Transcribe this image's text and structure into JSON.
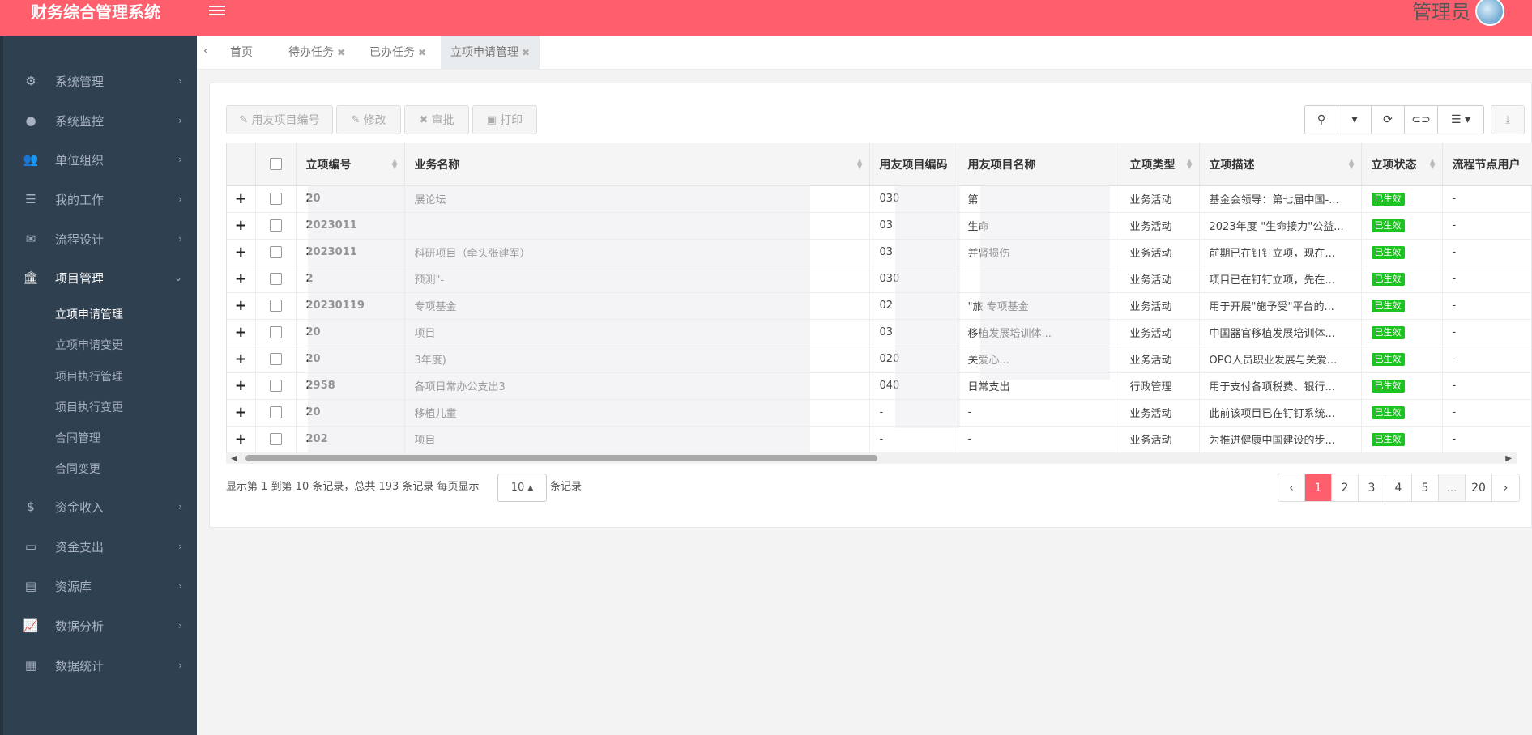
{
  "app": {
    "title": "财务综合管理系统",
    "user": "管理员"
  },
  "sidebar": {
    "items": [
      {
        "label": "系统管理",
        "icon": "gears-icon"
      },
      {
        "label": "系统监控",
        "icon": "info-circle-icon"
      },
      {
        "label": "单位组织",
        "icon": "users-icon"
      },
      {
        "label": "我的工作",
        "icon": "tasks-icon"
      },
      {
        "label": "流程设计",
        "icon": "envelope-icon"
      },
      {
        "label": "项目管理",
        "icon": "bank-icon"
      },
      {
        "label": "资金收入",
        "icon": "dollar-icon"
      },
      {
        "label": "资金支出",
        "icon": "credit-card-icon"
      },
      {
        "label": "资源库",
        "icon": "file-icon"
      },
      {
        "label": "数据分析",
        "icon": "line-chart-icon"
      },
      {
        "label": "数据统计",
        "icon": "calendar-icon"
      }
    ],
    "submenu": [
      "立项申请管理",
      "立项申请变更",
      "项目执行管理",
      "项目执行变更",
      "合同管理",
      "合同变更"
    ]
  },
  "tabs": [
    {
      "label": "首页"
    },
    {
      "label": "待办任务"
    },
    {
      "label": "已办任务"
    },
    {
      "label": "立项申请管理"
    }
  ],
  "toolbar": {
    "yonyou_code": "用友项目编号",
    "edit": "修改",
    "approve": "审批",
    "print": "打印"
  },
  "table": {
    "columns": [
      "立项编号",
      "业务名称",
      "用友项目编码",
      "用友项目名称",
      "立项类型",
      "立项描述",
      "立项状态",
      "流程节点用户"
    ],
    "rows": [
      {
        "id": "20",
        "name": "展论坛",
        "code": "030",
        "pname": "第",
        "type": "业务活动",
        "desc": "基金会领导：第七届中国-...",
        "status": "已生效",
        "node": "-"
      },
      {
        "id": "2023011",
        "name": "",
        "code": "03",
        "pname": "生命",
        "type": "业务活动",
        "desc": "2023年度-\"生命接力\"公益...",
        "status": "已生效",
        "node": "-"
      },
      {
        "id": "2023011",
        "name": "科研项目（牵头张建军）",
        "code": "03",
        "pname": "并肾损伤",
        "type": "业务活动",
        "desc": "前期已在钉钉立项，现在...",
        "status": "已生效",
        "node": "-"
      },
      {
        "id": "2",
        "name": "预测\"-",
        "code": "030",
        "pname": "",
        "type": "业务活动",
        "desc": "项目已在钉钉立项，先在...",
        "status": "已生效",
        "node": "-"
      },
      {
        "id": "20230119",
        "name": "专项基金",
        "code": "02",
        "pname": "\"旅  专项基金",
        "type": "业务活动",
        "desc": "用于开展\"施予受\"平台的...",
        "status": "已生效",
        "node": "-"
      },
      {
        "id": "20",
        "name": "项目",
        "code": "03",
        "pname": "移植发展培训体...",
        "type": "业务活动",
        "desc": "中国器官移植发展培训体...",
        "status": "已生效",
        "node": "-"
      },
      {
        "id": "20",
        "name": "3年度)",
        "code": "020",
        "pname": "关爱心...",
        "type": "业务活动",
        "desc": "OPO人员职业发展与关爱...",
        "status": "已生效",
        "node": "-"
      },
      {
        "id": "2958",
        "name": "各项日常办公支出3",
        "code": "040",
        "pname": "日常支出",
        "type": "行政管理",
        "desc": "用于支付各项税费、银行...",
        "status": "已生效",
        "node": "-"
      },
      {
        "id": "20",
        "name": "移植儿童",
        "code": "-",
        "pname": "-",
        "type": "业务活动",
        "desc": "此前该项目已在钉钉系统...",
        "status": "已生效",
        "node": "-"
      },
      {
        "id": "202",
        "name": "项目",
        "code": "-",
        "pname": "-",
        "type": "业务活动",
        "desc": "为推进健康中国建设的步...",
        "status": "已生效",
        "node": "-"
      }
    ]
  },
  "pagination": {
    "info": "显示第 1 到第 10 条记录，总共 193 条记录  每页显示",
    "page_size": "10",
    "suffix": "条记录",
    "pages": [
      "‹",
      "1",
      "2",
      "3",
      "4",
      "5",
      "...",
      "20",
      "›"
    ],
    "current": "1"
  },
  "colors": {
    "accent": "#ff5f6d",
    "sidebar": "#2f4050",
    "status_green": "#1cc421"
  }
}
